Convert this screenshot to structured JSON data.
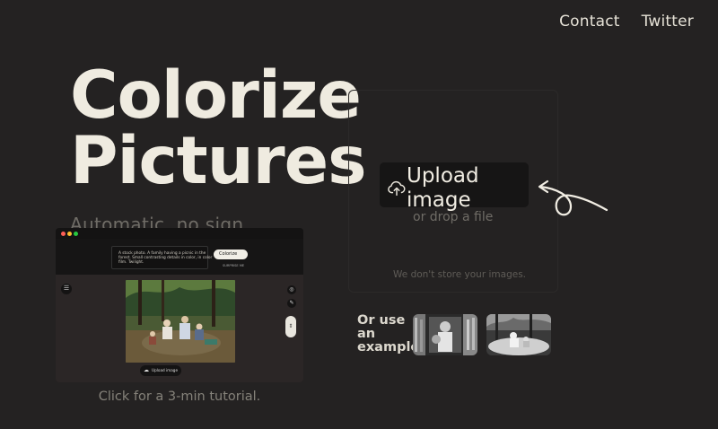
{
  "nav": {
    "contact": "Contact",
    "twitter": "Twitter"
  },
  "hero": {
    "line1": "Colorize",
    "line2": "Pictures",
    "subtitle": "Automatic, no sign"
  },
  "upload": {
    "button_label": "Upload image",
    "drop_text": "or drop a file",
    "privacy_note": "We don't store your images."
  },
  "examples": {
    "label": "Or use an example."
  },
  "video": {
    "prompt_text": "A stock photo. A family having a picnic in the forest. Small contrasting details in color, in color film. Twilight.",
    "colorize_label": "Colorize",
    "surprise_label": "SURPRISE ME",
    "upload_label": "Upload image",
    "caption": "Click for a 3-min tutorial."
  },
  "colors": {
    "background": "#242222",
    "text_primary": "#efebe0",
    "text_muted": "#6f6c66",
    "button_bg": "#161515"
  },
  "icons": [
    "upload-cloud-icon",
    "curved-arrow-icon",
    "menu-icon",
    "palette-icon",
    "pencil-icon",
    "zoom-slider-icon"
  ]
}
